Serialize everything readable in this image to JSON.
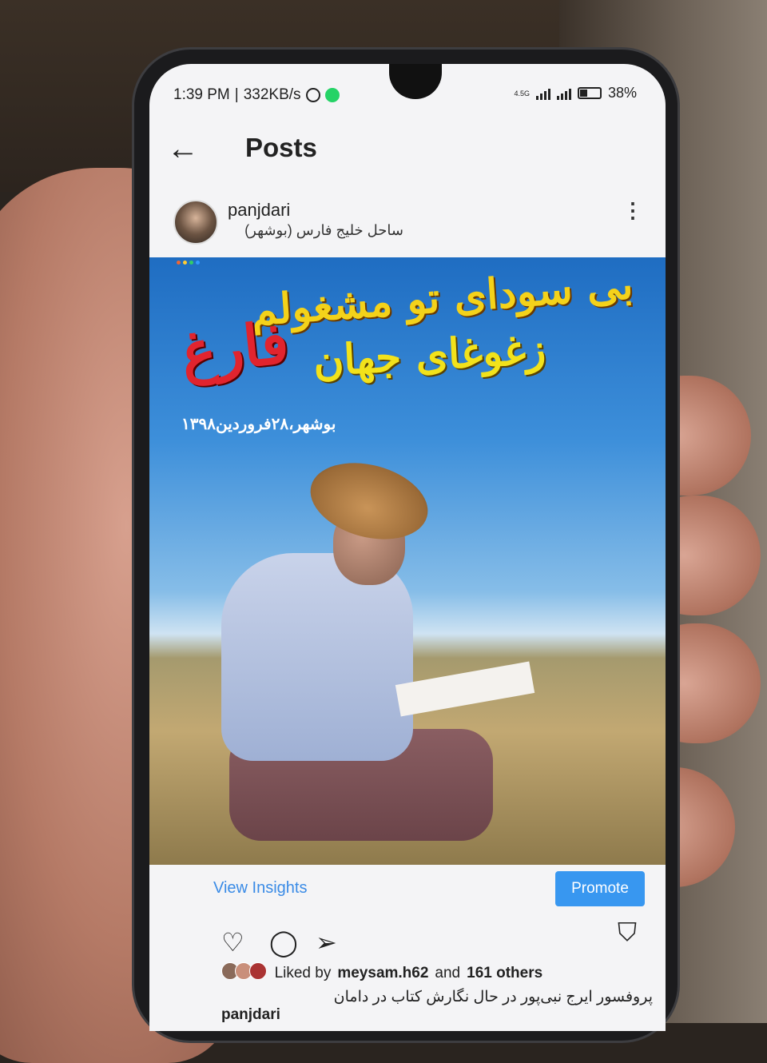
{
  "status_bar": {
    "time": "1:39 PM",
    "speed": "332KB/s",
    "network": "4.5G",
    "battery": "38%"
  },
  "header": {
    "back_icon": "arrow-left-icon",
    "title": "Posts"
  },
  "post": {
    "username": "panjdari",
    "location": "ساحل خلیج فارس (بوشهر)",
    "image": {
      "line1": "بی سودای تو مشغولم",
      "line2": "زغوغای جهان",
      "line3": "فارغ",
      "date": "بوشهر،۲۸فروردین۱۳۹۸"
    },
    "view_insights": "View Insights",
    "promote": "Promote",
    "liked_prefix": "Liked by",
    "liked_user": "meysam.h62",
    "liked_and": "and",
    "liked_others": "161 others",
    "caption_user": "panjdari",
    "caption_text": "پروفسور ایرج نبی‌پور در حال نگارش کتاب در دامان"
  },
  "colors": {
    "accent": "#3897f0",
    "link": "#3a8be6"
  }
}
